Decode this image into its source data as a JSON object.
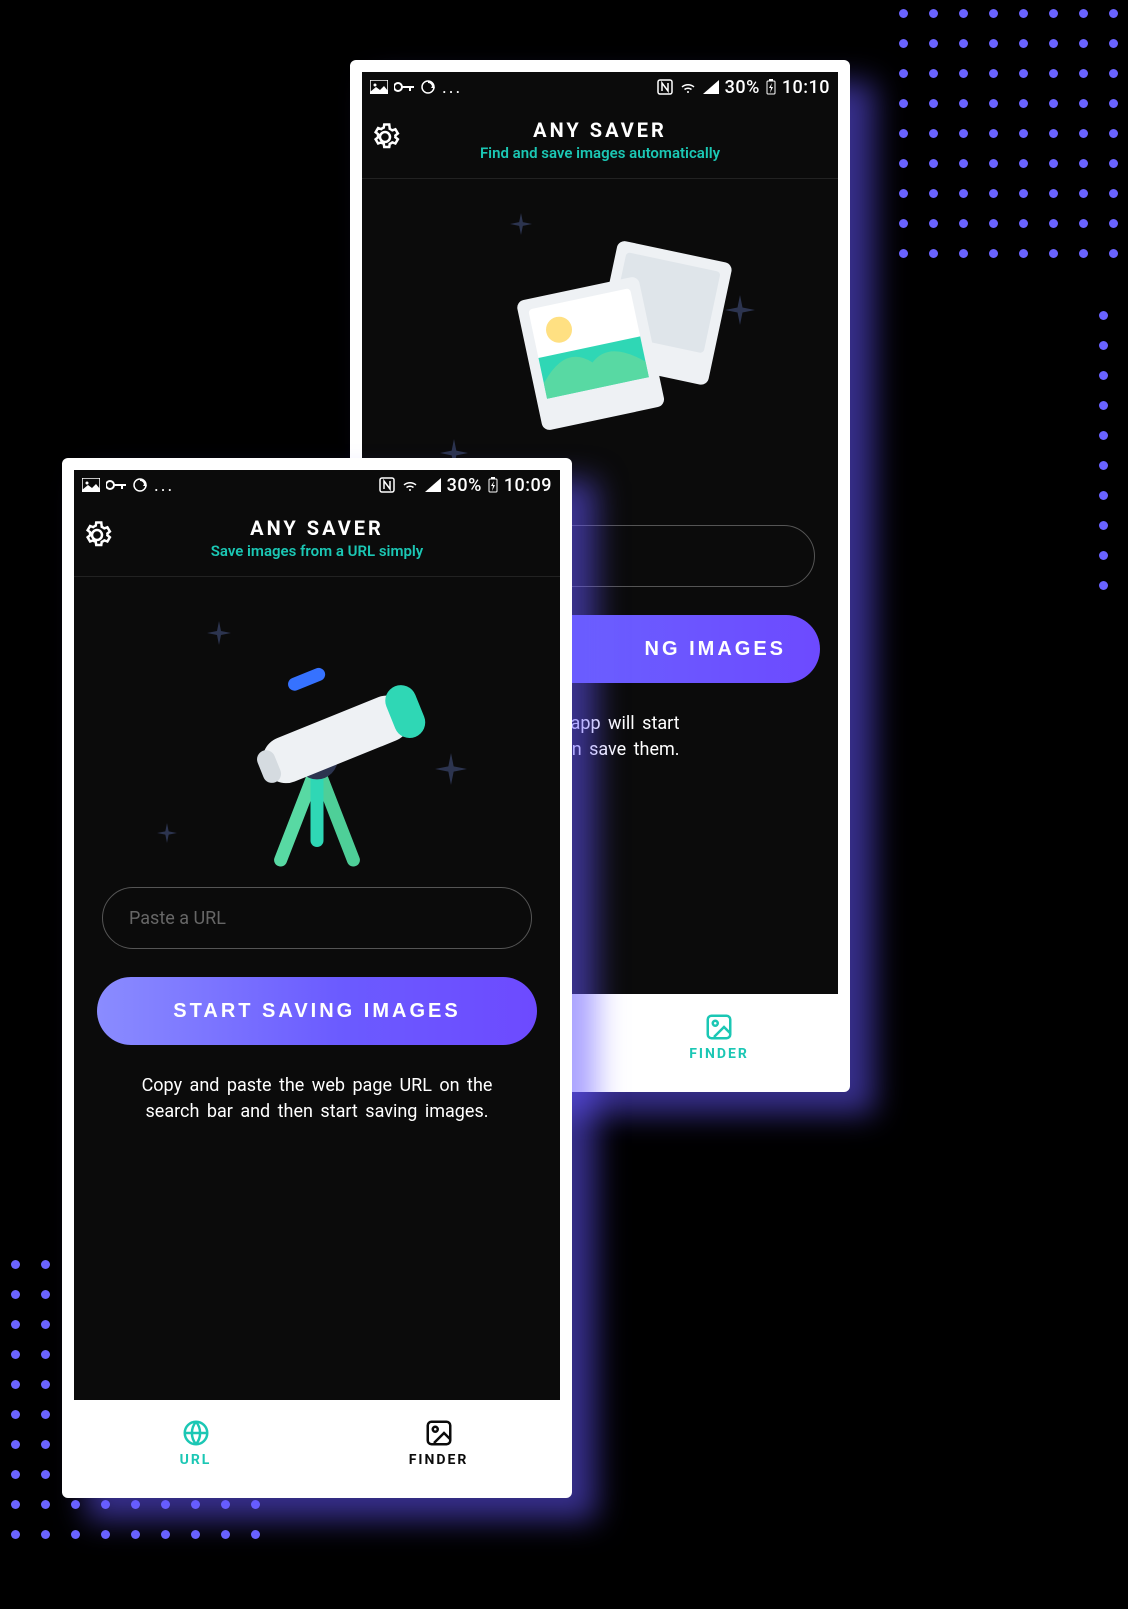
{
  "statusbar": {
    "battery_text": "30%",
    "time_back": "10:10",
    "time_front": "10:09",
    "icons_left": [
      "photo-icon",
      "key-icon",
      "sync-icon",
      "more-icon"
    ],
    "icons_right": [
      "nfc-icon",
      "wifi-icon",
      "signal-icon"
    ]
  },
  "header": {
    "app_title": "ANY SAVER",
    "subtitle_back": "Find and save images automatically",
    "subtitle_front": "Save images from a URL simply",
    "settings_tooltip": "Settings"
  },
  "back": {
    "button_label": "NG IMAGES",
    "help_line1": "d our app will start",
    "help_line2": "you can save them."
  },
  "front": {
    "url_placeholder": "Paste a URL",
    "button_label": "START SAVING IMAGES",
    "help_line1": "Copy and paste the web page URL on the",
    "help_line2": "search bar and then start saving images."
  },
  "tabs": {
    "url": {
      "label": "URL",
      "icon": "globe-icon"
    },
    "finder": {
      "label": "FINDER",
      "icon": "picture-icon"
    }
  },
  "colors": {
    "brand_cyan": "#1bc7b4",
    "brand_purple_a": "#8a8cff",
    "brand_purple_b": "#6d4aff"
  }
}
